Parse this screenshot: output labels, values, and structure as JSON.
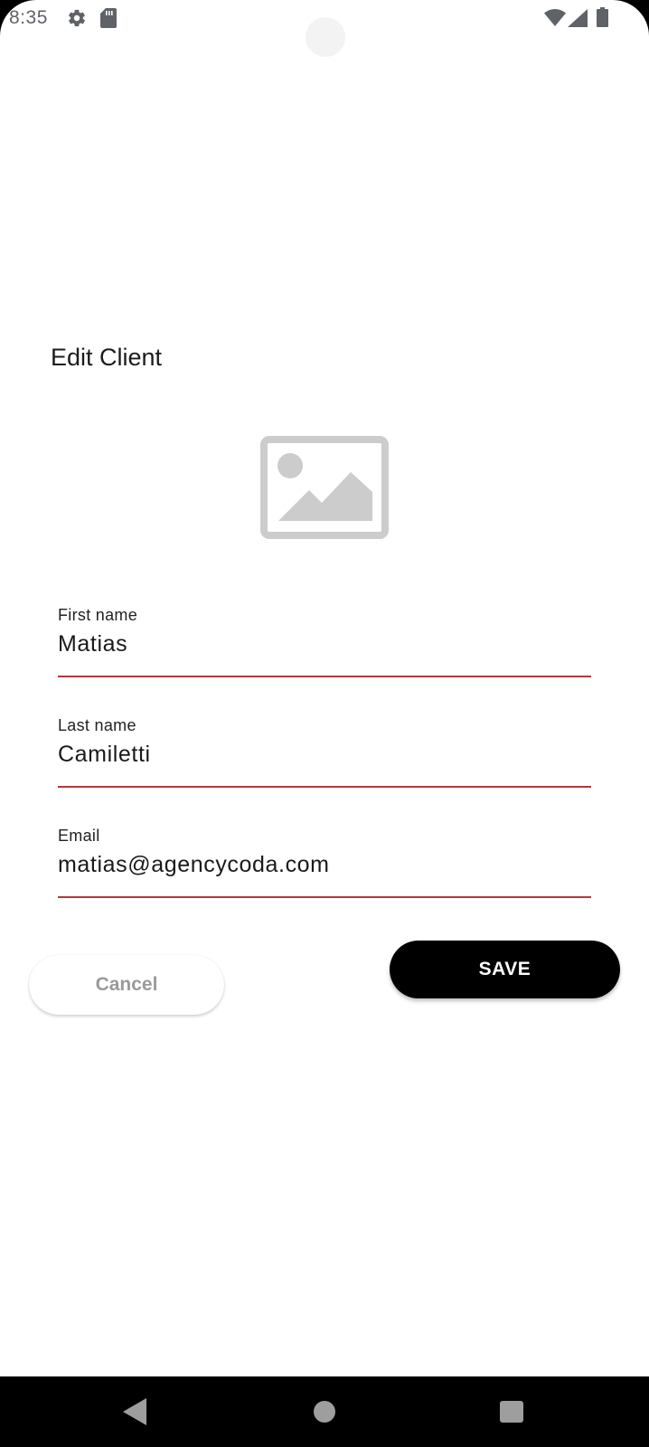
{
  "status_bar": {
    "time": "8:35",
    "icons": [
      "gear-icon",
      "sd-card-icon",
      "wifi-icon",
      "signal-icon",
      "battery-icon"
    ]
  },
  "page": {
    "title": "Edit Client",
    "image_placeholder_icon": "image-placeholder-icon"
  },
  "form": {
    "first_name": {
      "label": "First name",
      "value": "Matias"
    },
    "last_name": {
      "label": "Last name",
      "value": "Camiletti"
    },
    "email": {
      "label": "Email",
      "value": "matias@agencycoda.com"
    }
  },
  "actions": {
    "cancel_label": "Cancel",
    "save_label": "SAVE"
  },
  "nav_bar": {
    "icons": [
      "back-icon",
      "home-icon",
      "recents-icon"
    ]
  },
  "colors": {
    "field_underline": "#b0393f",
    "save_button_bg": "#000000",
    "cancel_text": "#9a9a9a"
  }
}
